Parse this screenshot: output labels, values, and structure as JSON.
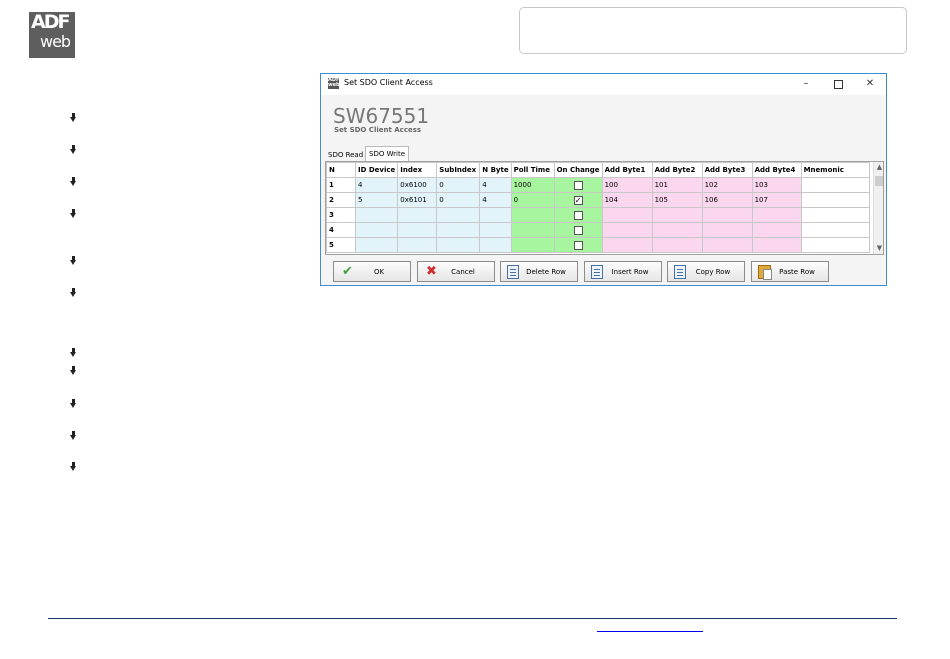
{
  "logo": {
    "line1": "ADF",
    "line2": "web"
  },
  "window": {
    "title": "Set SDO Client Access",
    "app_icon": "adfweb-app-icon",
    "controls": {
      "minimize": "–",
      "maximize": "",
      "close": "✕"
    },
    "heading": "SW67551",
    "subheading": "Set SDO Client Access",
    "tabs": [
      {
        "label": "SDO Read",
        "active": false
      },
      {
        "label": "SDO Write",
        "active": true
      }
    ],
    "table": {
      "columns": [
        "N",
        "ID Device",
        "Index",
        "SubIndex",
        "N Byte",
        "Poll Time",
        "On Change",
        "Add Byte1",
        "Add Byte2",
        "Add Byte3",
        "Add Byte4",
        "Mnemonic"
      ],
      "rows": [
        {
          "n": "1",
          "id_device": "4",
          "index": "0x6100",
          "subindex": "0",
          "n_byte": "4",
          "poll_time": "1000",
          "on_change": "",
          "b1": "100",
          "b2": "101",
          "b3": "102",
          "b4": "103",
          "mnemonic": ""
        },
        {
          "n": "2",
          "id_device": "5",
          "index": "0x6101",
          "subindex": "0",
          "n_byte": "4",
          "poll_time": "0",
          "on_change": "✓",
          "b1": "104",
          "b2": "105",
          "b3": "106",
          "b4": "107",
          "mnemonic": ""
        },
        {
          "n": "3",
          "id_device": "",
          "index": "",
          "subindex": "",
          "n_byte": "",
          "poll_time": "",
          "on_change": "",
          "b1": "",
          "b2": "",
          "b3": "",
          "b4": "",
          "mnemonic": ""
        },
        {
          "n": "4",
          "id_device": "",
          "index": "",
          "subindex": "",
          "n_byte": "",
          "poll_time": "",
          "on_change": "",
          "b1": "",
          "b2": "",
          "b3": "",
          "b4": "",
          "mnemonic": ""
        },
        {
          "n": "5",
          "id_device": "",
          "index": "",
          "subindex": "",
          "n_byte": "",
          "poll_time": "",
          "on_change": "",
          "b1": "",
          "b2": "",
          "b3": "",
          "b4": "",
          "mnemonic": ""
        }
      ]
    },
    "buttons": {
      "ok": {
        "label": "OK",
        "icon": "checkmark-icon"
      },
      "cancel": {
        "label": "Cancel",
        "icon": "x-cross-icon"
      },
      "delete_row": {
        "label": "Delete Row",
        "icon": "delete-row-icon"
      },
      "insert_row": {
        "label": "Insert Row",
        "icon": "insert-row-icon"
      },
      "copy_row": {
        "label": "Copy Row",
        "icon": "copy-icon"
      },
      "paste_row": {
        "label": "Paste Row",
        "icon": "paste-icon"
      }
    }
  },
  "colors": {
    "window_border": "#3c8dcf",
    "blue_cells": "#e2f4fa",
    "green_cells": "#a8f5a0",
    "pink_cells": "#fad7ef",
    "footer_line": "#1f3864"
  }
}
